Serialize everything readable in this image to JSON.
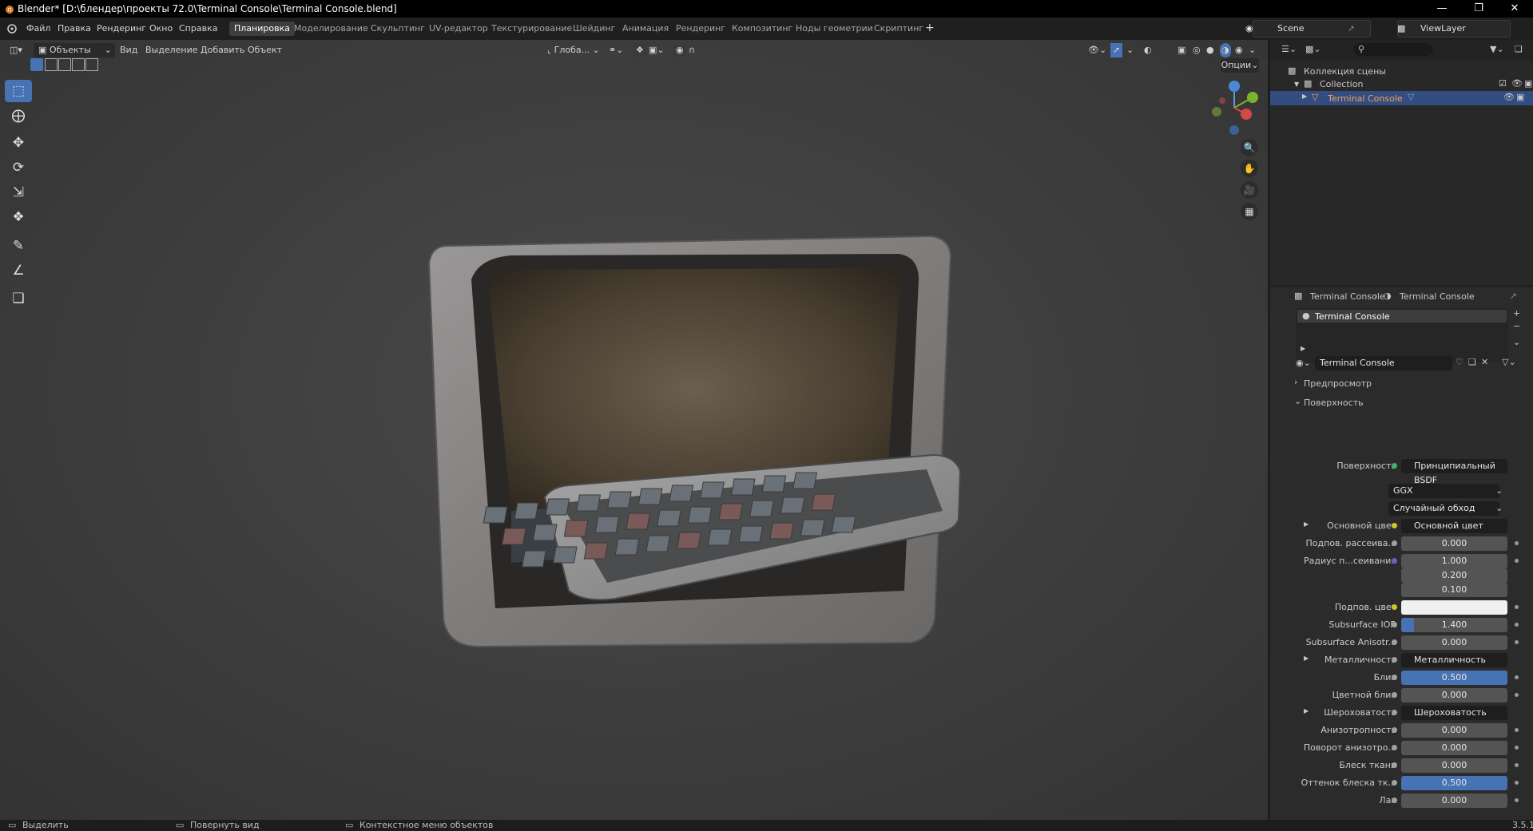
{
  "window": {
    "title": "Blender* [D:\\блендер\\проекты 72.0\\Terminal Console\\Terminal Console.blend]"
  },
  "menus": [
    "Файл",
    "Правка",
    "Рендеринг",
    "Окно",
    "Справка"
  ],
  "workspaces": [
    "Планировка",
    "Моделирование",
    "Скульптинг",
    "UV-редактор",
    "Текстурирование",
    "Шейдинг",
    "Анимация",
    "Рендеринг",
    "Композитинг",
    "Ноды геометрии",
    "Скриптинг"
  ],
  "active_workspace": "Планировка",
  "scene": {
    "name": "Scene",
    "viewlayer": "ViewLayer"
  },
  "viewport": {
    "mode": "Объекты",
    "menus": [
      "Вид",
      "Выделение",
      "Добавить",
      "Объект"
    ],
    "transform_orientation": "Глоба...",
    "options": "Опции"
  },
  "outliner": {
    "root": "Коллекция сцены",
    "collection": "Collection",
    "object": "Terminal Console"
  },
  "properties": {
    "breadcrumb_object": "Terminal Console",
    "breadcrumb_material": "Terminal Console",
    "slot": "Terminal Console",
    "material_name": "Terminal Console",
    "preview_label": "Предпросмотр",
    "surface_panel": "Поверхность",
    "rows": [
      {
        "label": "Поверхность",
        "value": "Принципиальный BSDF",
        "kind": "link"
      },
      {
        "label": "",
        "value": "GGX",
        "kind": "dropdown"
      },
      {
        "label": "",
        "value": "Случайный обход",
        "kind": "dropdown"
      },
      {
        "label": "Основной цвет",
        "value": "Основной цвет",
        "kind": "link"
      },
      {
        "label": "Подпов. рассеива...",
        "value": "0.000",
        "kind": "num"
      },
      {
        "label": "Радиус п...сеивания",
        "value": "1.000",
        "kind": "num"
      },
      {
        "label": "",
        "value": "0.200",
        "kind": "num"
      },
      {
        "label": "",
        "value": "0.100",
        "kind": "num"
      },
      {
        "label": "Подпов. цвет",
        "value": "",
        "kind": "color"
      },
      {
        "label": "Subsurface IOR",
        "value": "1.400",
        "kind": "num"
      },
      {
        "label": "Subsurface Anisotr...",
        "value": "0.000",
        "kind": "num"
      },
      {
        "label": "Металличность",
        "value": "Металличность",
        "kind": "link"
      },
      {
        "label": "Блик",
        "value": "0.500",
        "kind": "sel"
      },
      {
        "label": "Цветной блик",
        "value": "0.000",
        "kind": "num"
      },
      {
        "label": "Шероховатость",
        "value": "Шероховатость",
        "kind": "link"
      },
      {
        "label": "Анизотропность",
        "value": "0.000",
        "kind": "num"
      },
      {
        "label": "Поворот анизотро...",
        "value": "0.000",
        "kind": "num"
      },
      {
        "label": "Блеск ткани",
        "value": "0.000",
        "kind": "num"
      },
      {
        "label": "Оттенок блеска тк...",
        "value": "0.500",
        "kind": "sel"
      },
      {
        "label": "Лак",
        "value": "0.000",
        "kind": "num"
      }
    ]
  },
  "status": {
    "select": "Выделить",
    "rotate": "Повернуть вид",
    "context": "Контекстное меню объектов",
    "version": "3.5.1"
  }
}
